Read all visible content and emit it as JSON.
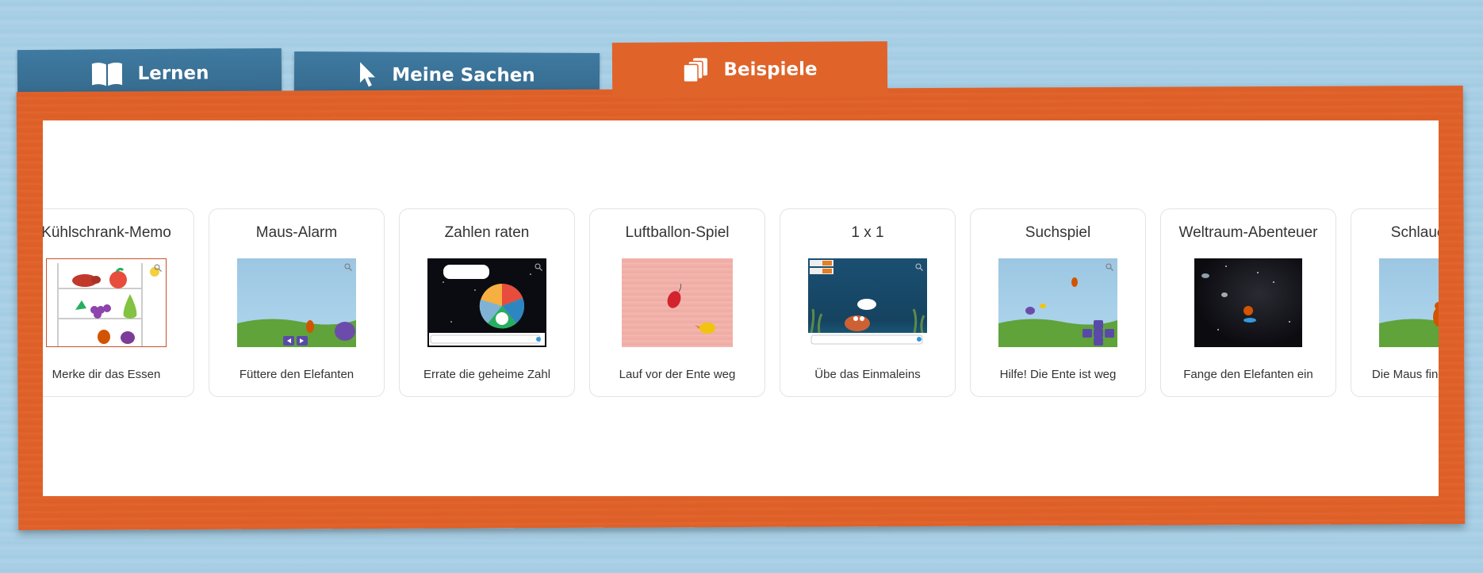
{
  "tabs": {
    "lernen": "Lernen",
    "meine_sachen": "Meine Sachen",
    "beispiele": "Beispiele"
  },
  "icons": {
    "lernen": "book-icon",
    "meine_sachen": "cursor-icon",
    "beispiele": "pages-icon"
  },
  "colors": {
    "tab_blue": "#3f7aa1",
    "tab_active_orange": "#e0632a",
    "background_blue": "#a9d0e6"
  },
  "examples": [
    {
      "title": "Kühlschrank-Memo",
      "description": "Merke dir das Essen"
    },
    {
      "title": "Maus-Alarm",
      "description": "Füttere den Elefanten"
    },
    {
      "title": "Zahlen raten",
      "description": "Errate die geheime Zahl"
    },
    {
      "title": "Luftballon-Spiel",
      "description": "Lauf vor der Ente weg"
    },
    {
      "title": "1 x 1",
      "description": "Übe das Einmaleins"
    },
    {
      "title": "Suchspiel",
      "description": "Hilfe! Die Ente ist weg"
    },
    {
      "title": "Weltraum-Abenteuer",
      "description": "Fange den Elefanten ein"
    },
    {
      "title": "Schlaue Maus",
      "description": "Die Maus findet den Weg"
    }
  ]
}
